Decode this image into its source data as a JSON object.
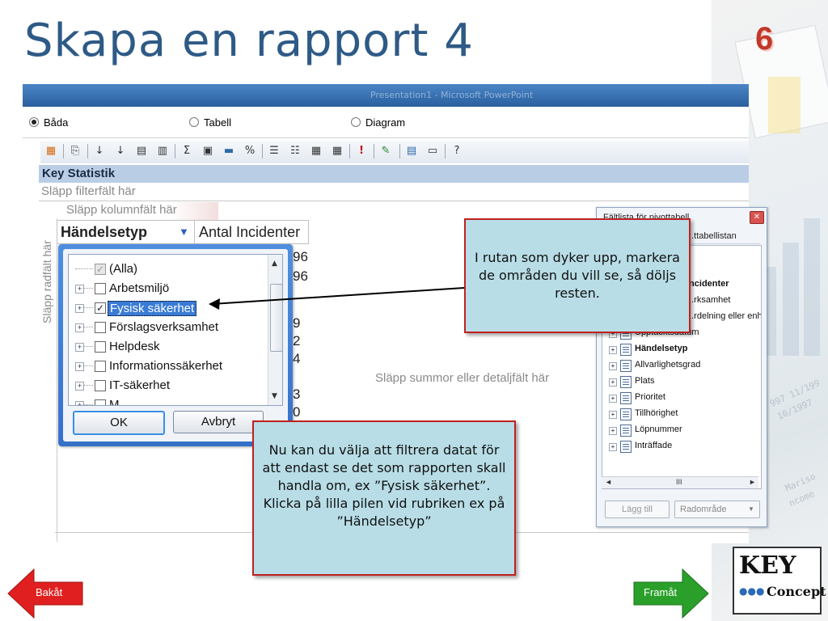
{
  "slide": {
    "title": "Skapa en rapport 4",
    "number": "6"
  },
  "app": {
    "window_title": "Presentation1 - Microsoft PowerPoint",
    "view_options": {
      "both": "Båda",
      "table": "Tabell",
      "chart": "Diagram",
      "selected": "both"
    },
    "toolbar_icons": [
      "format-report-icon",
      "copy-icon",
      "sort-ascending-icon",
      "sort-descending-icon",
      "autofilter-icon",
      "show-top-icon",
      "subtotal-icon",
      "group-icon",
      "chart-icon",
      "percent-icon",
      "expand-icon",
      "collapse-icon",
      "hide-details-icon",
      "show-details-icon",
      "refresh-icon",
      "field-list-icon",
      "export-excel-icon",
      "commands-icon",
      "properties-icon",
      "help-icon"
    ]
  },
  "pivot": {
    "title": "Key Statistik",
    "filter_drop_zone": "Släpp filterfält här",
    "column_drop_zone": "Släpp kolumnfält här",
    "row_drop_zone": "Släpp radfält här",
    "data_drop_zone": "Släpp summor eller detaljfält här",
    "row_field": "Händelsetyp",
    "total_field": "Antal Incidenter",
    "visible_values": [
      "96",
      "96",
      "9",
      "2",
      "4",
      "3",
      "0"
    ]
  },
  "filter_dropdown": {
    "items": [
      {
        "label": "(Alla)",
        "checked": "partial",
        "expandable": false
      },
      {
        "label": "Arbetsmiljö",
        "checked": false,
        "expandable": true
      },
      {
        "label": "Fysisk säkerhet",
        "checked": true,
        "expandable": true,
        "selected": true
      },
      {
        "label": "Förslagsverksamhet",
        "checked": false,
        "expandable": true
      },
      {
        "label": "Helpdesk",
        "checked": false,
        "expandable": true
      },
      {
        "label": "Informationssäkerhet",
        "checked": false,
        "expandable": true
      },
      {
        "label": "IT-säkerhet",
        "checked": false,
        "expandable": true
      },
      {
        "label": "M...",
        "checked": false,
        "expandable": true
      }
    ],
    "ok_label": "OK",
    "cancel_label": "Avbryt"
  },
  "field_list": {
    "title": "Fältlista för pivottabell",
    "subtitle": "...ttabellistan",
    "items": [
      {
        "label": "Incidenter",
        "bold": true
      },
      {
        "label": "...rksamhet",
        "bold": false
      },
      {
        "label": "...rdelning eller enhe",
        "bold": false
      },
      {
        "label": "Upptäcktsdatum",
        "bold": false
      },
      {
        "label": "Händelsetyp",
        "bold": true
      },
      {
        "label": "Allvarlighetsgrad",
        "bold": false
      },
      {
        "label": "Plats",
        "bold": false
      },
      {
        "label": "Prioritet",
        "bold": false
      },
      {
        "label": "Tillhörighet",
        "bold": false
      },
      {
        "label": "Löpnummer",
        "bold": false
      },
      {
        "label": "Inträffade",
        "bold": false
      }
    ],
    "scroll_label": "III",
    "add_button": "Lägg till",
    "area_select": "Radområde"
  },
  "callouts": {
    "first": "I rutan som dyker upp, markera de områden du vill se, så döljs resten.",
    "second": "Nu kan du välja att filtrera datat för att endast se det som rapporten skall handla om, ex ”Fysisk säkerhet”.\nKlicka på lilla pilen vid rubriken ex på ”Händelsetyp”"
  },
  "navigation": {
    "back": "Bakåt",
    "forward": "Framåt"
  },
  "logo": {
    "line1": "KEY",
    "line2": "Concept"
  },
  "colors": {
    "title": "#2e5a86",
    "number": "#c0392b",
    "callout_bg": "#b8dde6",
    "callout_border": "#c02020",
    "back_arrow": "#e02020",
    "forward_arrow": "#2aa02a",
    "header_band": "#b9cde5"
  }
}
